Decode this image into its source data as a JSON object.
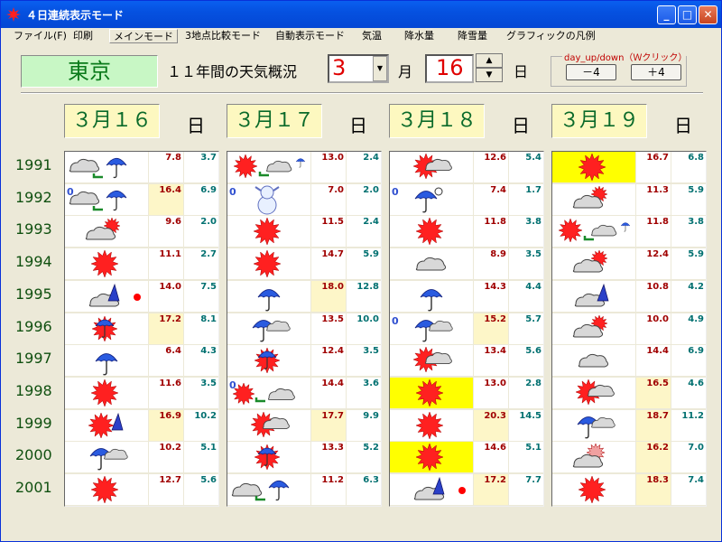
{
  "window": {
    "title": "４日連続表示モード"
  },
  "menu": [
    "ファイル(F)",
    "印刷",
    "メインモード",
    "3地点比較モード",
    "自動表示モード",
    "気温",
    "降水量",
    "降雪量",
    "グラフィックの凡例"
  ],
  "header": {
    "city": "東京",
    "summary": "１１年間の天気概況",
    "month_value": "3",
    "month_label": "月",
    "day_value": "16",
    "day_label": "日",
    "updown_legend": "day_up/down（Ｗクリック）",
    "minus_label": "－4",
    "plus_label": "＋4"
  },
  "years": [
    "1991",
    "1992",
    "1993",
    "1994",
    "1995",
    "1996",
    "1997",
    "1998",
    "1999",
    "2000",
    "2001"
  ],
  "days": [
    {
      "label": "３月１６",
      "suffix": "日",
      "rows": [
        {
          "icon": "cloud-sun-umbrella",
          "temp": "7.8",
          "precip": "3.7"
        },
        {
          "icon": "cloud-sun-umbrella",
          "temp": "16.4",
          "precip": "6.9",
          "zero": "0",
          "cy": true
        },
        {
          "icon": "cloud-sun",
          "temp": "9.6",
          "precip": "2.0"
        },
        {
          "icon": "sun",
          "temp": "11.1",
          "precip": "2.7"
        },
        {
          "icon": "cloud-snowpeak-dot",
          "temp": "14.0",
          "precip": "7.5"
        },
        {
          "icon": "sun-umbrella",
          "temp": "17.2",
          "precip": "8.1",
          "cy": true
        },
        {
          "icon": "umbrella",
          "temp": "6.4",
          "precip": "4.3"
        },
        {
          "icon": "sun",
          "temp": "11.6",
          "precip": "3.5"
        },
        {
          "icon": "sun-snowpeak",
          "temp": "16.9",
          "precip": "10.2",
          "cy": true
        },
        {
          "icon": "umbrella-cloud",
          "temp": "10.2",
          "precip": "5.1"
        },
        {
          "icon": "sun",
          "temp": "12.7",
          "precip": "5.6"
        }
      ]
    },
    {
      "label": "３月１７",
      "suffix": "日",
      "rows": [
        {
          "icon": "sun-cloud-umbrella-small",
          "temp": "13.0",
          "precip": "2.4"
        },
        {
          "icon": "snowman",
          "temp": "7.0",
          "precip": "2.0",
          "zero": "0"
        },
        {
          "icon": "sun",
          "temp": "11.5",
          "precip": "2.4"
        },
        {
          "icon": "sun",
          "temp": "14.7",
          "precip": "5.9"
        },
        {
          "icon": "umbrella",
          "temp": "18.0",
          "precip": "12.8",
          "cy": true
        },
        {
          "icon": "umbrella-cloud",
          "temp": "13.5",
          "precip": "10.0"
        },
        {
          "icon": "sun-umbrella",
          "temp": "12.4",
          "precip": "3.5"
        },
        {
          "icon": "sun-cloud",
          "temp": "14.4",
          "precip": "3.6",
          "zero": "0"
        },
        {
          "icon": "sun-cloud2",
          "temp": "17.7",
          "precip": "9.9",
          "cy": true
        },
        {
          "icon": "sun-umbrella",
          "temp": "13.3",
          "precip": "5.2"
        },
        {
          "icon": "cloud-umbrella",
          "temp": "11.2",
          "precip": "6.3"
        }
      ]
    },
    {
      "label": "３月１８",
      "suffix": "日",
      "rows": [
        {
          "icon": "sun-cloud2",
          "temp": "12.6",
          "precip": "5.4"
        },
        {
          "icon": "umbrella-wind",
          "temp": "7.4",
          "precip": "1.7",
          "zero": "0"
        },
        {
          "icon": "sun",
          "temp": "11.8",
          "precip": "3.8"
        },
        {
          "icon": "cloud",
          "temp": "8.9",
          "precip": "3.5"
        },
        {
          "icon": "umbrella",
          "temp": "14.3",
          "precip": "4.4"
        },
        {
          "icon": "umbrella-cloud",
          "temp": "15.2",
          "precip": "5.7",
          "zero": "0",
          "cy": true
        },
        {
          "icon": "sun-cloud2",
          "temp": "13.4",
          "precip": "5.6"
        },
        {
          "icon": "sun",
          "temp": "13.0",
          "precip": "2.8",
          "hl": true
        },
        {
          "icon": "sun",
          "temp": "20.3",
          "precip": "14.5",
          "cy": true
        },
        {
          "icon": "sun",
          "temp": "14.6",
          "precip": "5.1",
          "hl": true
        },
        {
          "icon": "cloud-snowpeak-dot",
          "temp": "17.2",
          "precip": "7.7",
          "cy": true
        }
      ]
    },
    {
      "label": "３月１９",
      "suffix": "日",
      "rows": [
        {
          "icon": "sun",
          "temp": "16.7",
          "precip": "6.8",
          "hl": true
        },
        {
          "icon": "cloud-sun",
          "temp": "11.3",
          "precip": "5.9"
        },
        {
          "icon": "sun-cloud-umbrella-small",
          "temp": "11.8",
          "precip": "3.8"
        },
        {
          "icon": "cloud-sun",
          "temp": "12.4",
          "precip": "5.9"
        },
        {
          "icon": "cloud-snowpeak",
          "temp": "10.8",
          "precip": "4.2"
        },
        {
          "icon": "cloud-sun",
          "temp": "10.0",
          "precip": "4.9"
        },
        {
          "icon": "cloud",
          "temp": "14.4",
          "precip": "6.9"
        },
        {
          "icon": "sun-cloud2",
          "temp": "16.5",
          "precip": "4.6",
          "cy": true
        },
        {
          "icon": "umbrella-cloud",
          "temp": "18.7",
          "precip": "11.2",
          "cy": true
        },
        {
          "icon": "cloud-pinksun",
          "temp": "16.2",
          "precip": "7.0",
          "cy": true
        },
        {
          "icon": "sun",
          "temp": "18.3",
          "precip": "7.4",
          "cy": true
        }
      ]
    }
  ]
}
